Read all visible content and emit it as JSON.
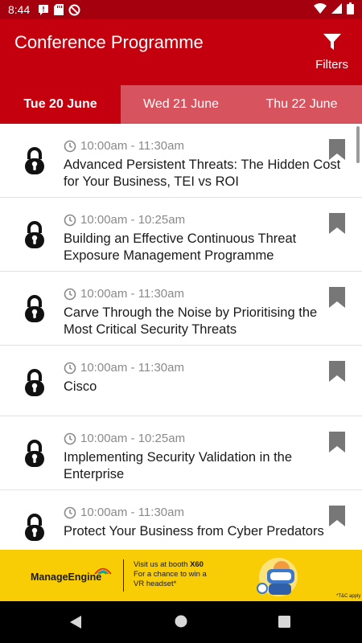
{
  "status_bar": {
    "time": "8:44",
    "icons": [
      "notification-icon",
      "sd-card-icon",
      "do-not-disturb-icon",
      "wifi-icon",
      "cellular-icon",
      "battery-icon"
    ]
  },
  "header": {
    "title": "Conference Programme",
    "filters_label": "Filters",
    "filters_icon": "filter-funnel-icon"
  },
  "tabs": [
    {
      "label": "Tue 20 June",
      "active": true
    },
    {
      "label": "Wed 21 June",
      "active": false
    },
    {
      "label": "Thu 22 June",
      "active": false
    }
  ],
  "sessions": [
    {
      "time": "10:00am - 11:30am",
      "title": "Advanced Persistent Threats: The Hidden Cost for Your Business, TEI vs ROI",
      "icon": "lock-icon"
    },
    {
      "time": "10:00am - 10:25am",
      "title": "Building an Effective Continuous Threat Exposure Management Programme",
      "icon": "lock-icon"
    },
    {
      "time": "10:00am - 11:30am",
      "title": "Carve Through the Noise by Prioritising the Most Critical Security Threats",
      "icon": "lock-icon"
    },
    {
      "time": "10:00am - 11:30am",
      "title": "Cisco",
      "icon": "lock-icon"
    },
    {
      "time": "10:00am - 10:25am",
      "title": "Implementing Security Validation in the Enterprise",
      "icon": "lock-icon"
    },
    {
      "time": "10:00am - 11:30am",
      "title": "Protect Your Business from Cyber Predators",
      "icon": "lock-icon"
    }
  ],
  "ad": {
    "brand": "ManageEngine",
    "line1_prefix": "Visit us at booth ",
    "line1_booth": "X60",
    "line2": "For a chance to win a",
    "line3": "VR headset*",
    "tc": "*T&C apply"
  },
  "colors": {
    "status_bar": "#a4000d",
    "app_bar": "#c4000e",
    "tab_inactive": "#d7535e",
    "ad_background": "#f8cd06"
  }
}
